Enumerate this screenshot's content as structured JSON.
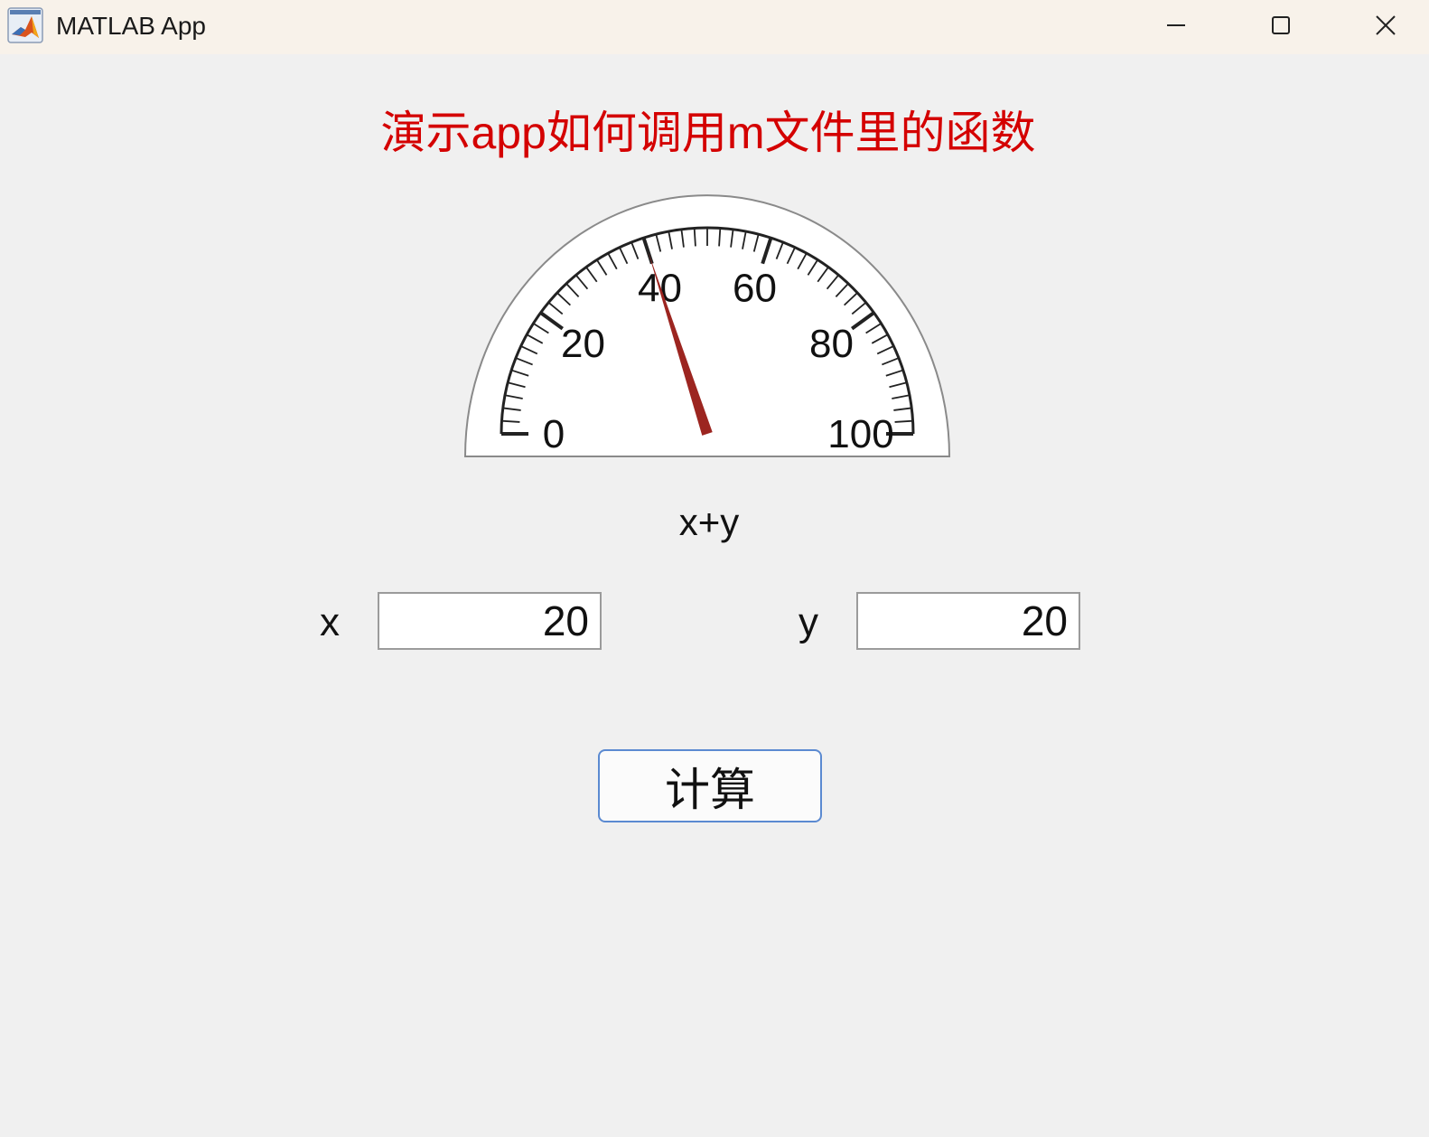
{
  "window": {
    "title": "MATLAB App",
    "icon": "matlab-membrane-icon",
    "controls": [
      "minimize-icon",
      "maximize-icon",
      "close-icon"
    ]
  },
  "main": {
    "heading": "演示app如何调用m文件里的函数",
    "heading_color": "#d40000"
  },
  "gauge": {
    "label": "x+y",
    "min": 0,
    "max": 100,
    "value": 40,
    "major_ticks": [
      "0",
      "20",
      "40",
      "60",
      "80",
      "100"
    ],
    "needle_color": "#9c2520"
  },
  "inputs": {
    "x": {
      "label": "x",
      "value": "20"
    },
    "y": {
      "label": "y",
      "value": "20"
    }
  },
  "button": {
    "label": "计算",
    "border_color": "#5b8ad1"
  }
}
